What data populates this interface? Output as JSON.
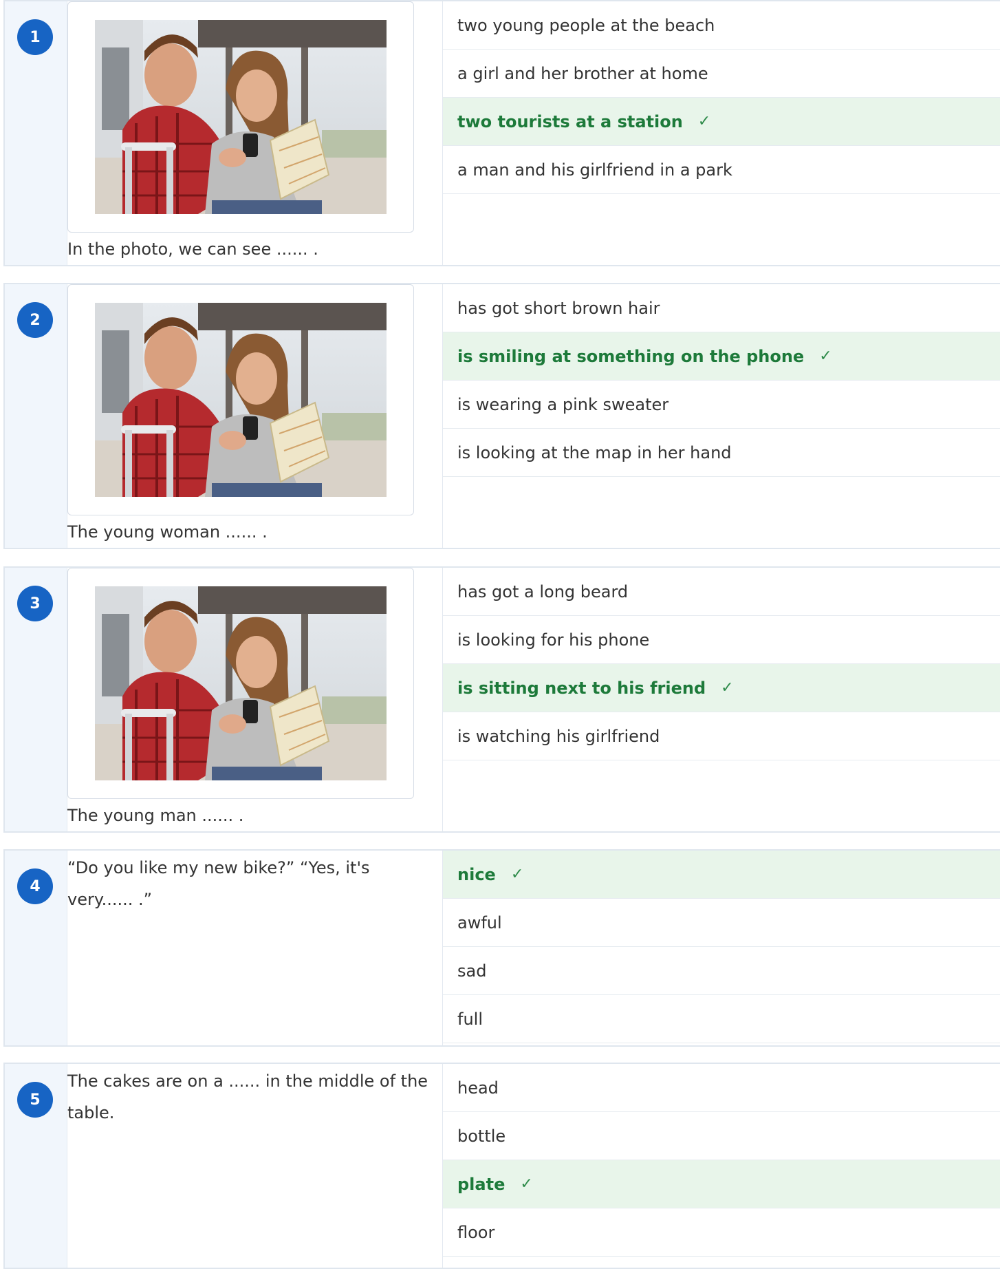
{
  "colors": {
    "number_badge": "#1764c4",
    "correct_bg": "#e8f5ea",
    "correct_text": "#1d7a3a",
    "gutter_bg": "#f1f6fc"
  },
  "check_mark": "✓",
  "questions": [
    {
      "number": "1",
      "has_image": true,
      "prompt": "In the photo, we can see ...... .",
      "options": [
        {
          "label": "two young people at the beach",
          "correct": false
        },
        {
          "label": "a girl and her brother at home",
          "correct": false
        },
        {
          "label": "two tourists at a station",
          "correct": true
        },
        {
          "label": "a man and his girlfriend in a park",
          "correct": false
        }
      ]
    },
    {
      "number": "2",
      "has_image": true,
      "prompt": "The young woman ...... .",
      "options": [
        {
          "label": "has got short brown hair",
          "correct": false
        },
        {
          "label": "is smiling at something on the phone",
          "correct": true
        },
        {
          "label": "is wearing a pink sweater",
          "correct": false
        },
        {
          "label": "is looking at the map in her hand",
          "correct": false
        }
      ]
    },
    {
      "number": "3",
      "has_image": true,
      "prompt": "The young man ...... .",
      "options": [
        {
          "label": "has got a long beard",
          "correct": false
        },
        {
          "label": "is looking for his phone",
          "correct": false
        },
        {
          "label": "is sitting next to his friend",
          "correct": true
        },
        {
          "label": "is watching his girlfriend",
          "correct": false
        }
      ]
    },
    {
      "number": "4",
      "has_image": false,
      "prompt": "“Do you like my new bike?” “Yes, it's very...... .”",
      "options": [
        {
          "label": "nice",
          "correct": true
        },
        {
          "label": "awful",
          "correct": false
        },
        {
          "label": "sad",
          "correct": false
        },
        {
          "label": "full",
          "correct": false
        }
      ]
    },
    {
      "number": "5",
      "has_image": false,
      "prompt": "The cakes are on a ...... in the middle of the table.",
      "options": [
        {
          "label": "head",
          "correct": false
        },
        {
          "label": "bottle",
          "correct": false
        },
        {
          "label": "plate",
          "correct": true
        },
        {
          "label": "floor",
          "correct": false
        }
      ]
    }
  ]
}
